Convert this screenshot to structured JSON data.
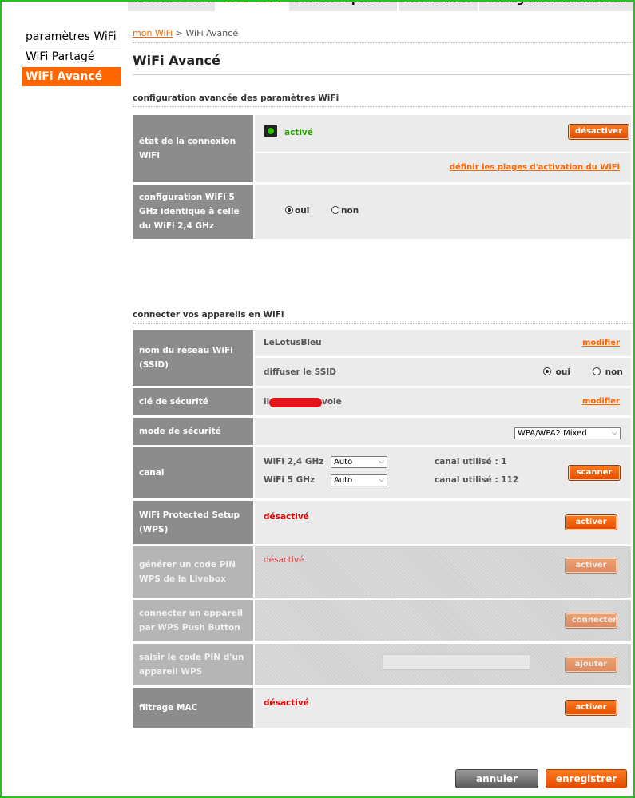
{
  "top_tabs": [
    "mon réseau",
    "mon WiFi",
    "mon téléphone",
    "assistance",
    "configuration avancée"
  ],
  "sidebar": {
    "items": [
      {
        "label": "paramètres WiFi"
      },
      {
        "label": "WiFi Partagé"
      },
      {
        "label": "WiFi Avancé"
      }
    ]
  },
  "breadcrumb": {
    "link": "mon WiFi",
    "current": " > WiFi Avancé"
  },
  "page_title": "WiFi Avancé",
  "section1": {
    "title": "configuration avancée des paramètres WiFi",
    "state_label": "état de la connexion WiFi",
    "state_value": "activé",
    "deactivate_btn": "désactiver",
    "schedule_link": "définir les plages d'activation du WiFi",
    "identical_label": "configuration WiFi 5 GHz identique à celle du WiFi 2,4 GHz",
    "yes": "oui",
    "no": "non"
  },
  "section2": {
    "title": "connecter vos appareils en WiFi",
    "ssid_label": "nom du réseau WiFi (SSID)",
    "ssid_value": "LeLotusBleu",
    "modify": "modifier",
    "broadcast_label": "diffuser le SSID",
    "yes": "oui",
    "no": "non",
    "key_label": "clé de sécurité",
    "key_prefix": "il",
    "key_suffix": "voie",
    "security_label": "mode de sécurité",
    "security_value": "WPA/WPA2 Mixed",
    "channel_label": "canal",
    "wifi24": "WiFi 2,4 GHz",
    "wifi5": "WiFi 5 GHz",
    "auto": "Auto",
    "used24": "canal utilisé : 1",
    "used5": "canal utilisé : 112",
    "scan_btn": "scanner",
    "wps_label": "WiFi Protected Setup (WPS)",
    "wps_value": "désactivé",
    "activate_btn": "activer",
    "pin_label": "générer un code PIN WPS de la Livebox",
    "pin_value": "désactivé",
    "push_label": "connecter un appareil par WPS Push Button",
    "connect_btn": "connecter",
    "enter_pin_label": "saisir le code PIN d'un appareil WPS",
    "add_btn": "ajouter",
    "mac_label": "filtrage MAC",
    "mac_value": "désactivé"
  },
  "footer": {
    "cancel": "annuler",
    "save": "enregistrer"
  }
}
